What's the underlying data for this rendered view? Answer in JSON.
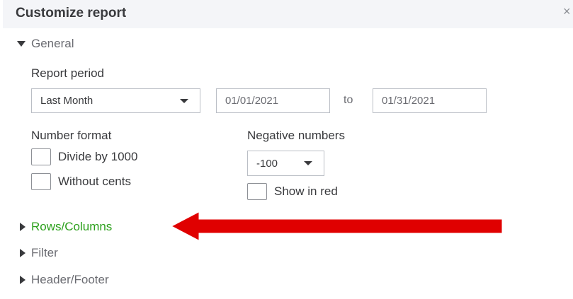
{
  "header": {
    "title": "Customize report",
    "close_glyph": "×"
  },
  "general": {
    "label": "General",
    "report_period": {
      "label": "Report period",
      "selected": "Last Month",
      "from": "01/01/2021",
      "to_label": "to",
      "to": "01/31/2021"
    },
    "number_format": {
      "label": "Number format",
      "options": [
        "Divide by 1000",
        "Without cents"
      ]
    },
    "negative_numbers": {
      "label": "Negative numbers",
      "selected": "-100",
      "show_in_red": "Show in red"
    }
  },
  "sections": [
    "Rows/Columns",
    "Filter",
    "Header/Footer"
  ],
  "colors": {
    "accent_green": "#2ca01c",
    "annotation_red": "#e00000"
  }
}
